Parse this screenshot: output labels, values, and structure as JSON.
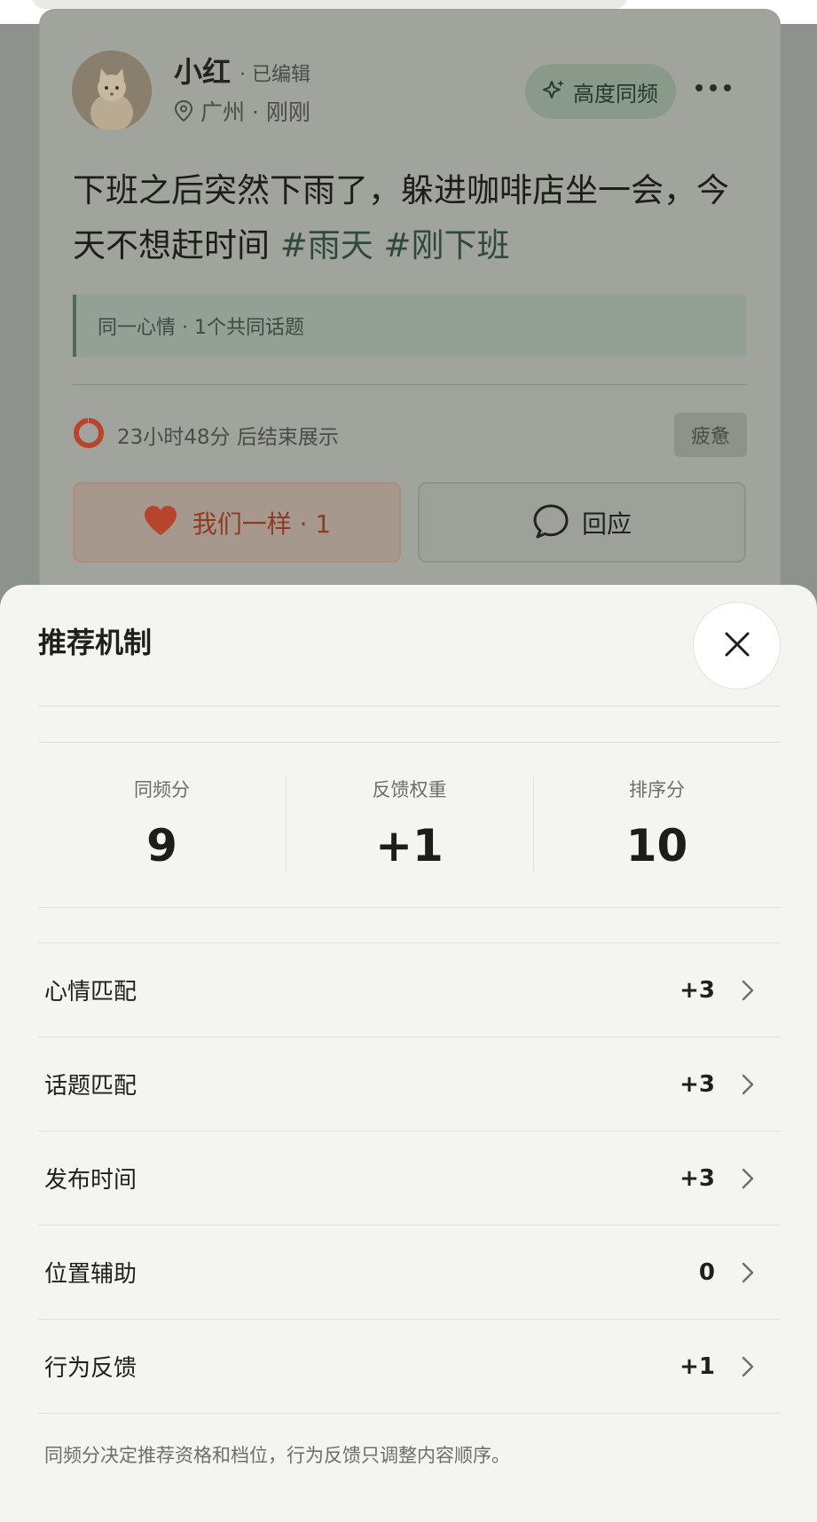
{
  "post": {
    "user_name": "小红",
    "edited": "· 已编辑",
    "location": "广州 · 刚刚",
    "frequency_tag": "高度同频",
    "text": "下班之后突然下雨了，躲进咖啡店坐一会，今天不想赶时间",
    "hashtags": [
      "#雨天",
      "#刚下班"
    ],
    "topic_hint": "同一心情 · 1个共同话题",
    "countdown": "23小时48分 后结束展示",
    "countdown_progress": 0.99,
    "mood": "疲惫",
    "same_button": "我们一样 · 1",
    "reply_button": "回应"
  },
  "sheet": {
    "title": "推荐机制",
    "stats": [
      {
        "label": "同频分",
        "value": "9"
      },
      {
        "label": "反馈权重",
        "value": "+1"
      },
      {
        "label": "排序分",
        "value": "10"
      }
    ],
    "rows": [
      {
        "label": "心情匹配",
        "value": "+3"
      },
      {
        "label": "话题匹配",
        "value": "+3"
      },
      {
        "label": "发布时间",
        "value": "+3"
      },
      {
        "label": "位置辅助",
        "value": "0"
      },
      {
        "label": "行为反馈",
        "value": "+1"
      }
    ],
    "footnote": "同频分决定推荐资格和档位，行为反馈只调整内容顺序。"
  },
  "icons": {
    "more": "more-horizontal-icon",
    "close": "close-icon",
    "location": "location-pin-icon",
    "sparkle": "sparkle-icon",
    "heart": "heart-icon",
    "comment": "comment-bubble-icon",
    "chevron": "chevron-right-icon"
  },
  "colors": {
    "accent_red": "#c74a32",
    "accent_green": "#2f4a38",
    "sheet_bg": "#f4f4f0"
  }
}
